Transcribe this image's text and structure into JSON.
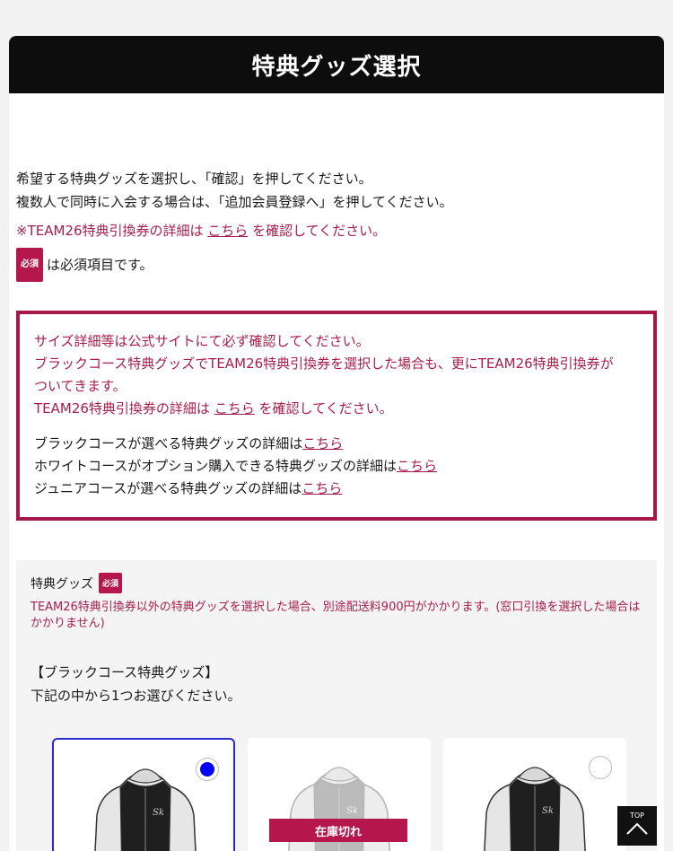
{
  "header": {
    "title": "特典グッズ選択"
  },
  "intro": {
    "line1": "希望する特典グッズを選択し、「確認」を押してください。",
    "line2": "複数人で同時に入会する場合は、「追加会員登録へ」を押してください。",
    "notice_prefix": "※TEAM26特典引換券の詳細は",
    "notice_link": "こちら",
    "notice_suffix": "を確認してください。",
    "required_badge": "必須",
    "required_text": "は必須項目です。"
  },
  "notice_box": {
    "line1": "サイズ詳細等は公式サイトにて必ず確認してください。",
    "line2": "ブラックコース特典グッズでTEAM26特典引換券を選択した場合も、更にTEAM26特典引換券が",
    "line3": "ついてきます。",
    "line4_prefix": "TEAM26特典引換券の詳細は",
    "line4_link": "こちら",
    "line4_suffix": "を確認してください。",
    "black_text": "ブラックコースが選べる特典グッズの詳細は",
    "black_link": "こちら",
    "white_text": "ホワイトコースがオプション購入できる特典グッズの詳細は",
    "white_link": "こちら",
    "junior_text": "ジュニアコースが選べる特典グッズの詳細は",
    "junior_link": "こちら"
  },
  "goods": {
    "title": "特典グッズ",
    "required_badge": "必須",
    "note": "TEAM26特典引換券以外の特典グッズを選択した場合、別途配送料900円がかかります。(窓口引換を選択した場合はかかりません)",
    "section_title": "【ブラックコース特典グッズ】",
    "section_sub": "下記の中から1つお選びください。",
    "items": [
      {
        "selected": true,
        "out_of_stock": false,
        "stock_label": ""
      },
      {
        "selected": false,
        "out_of_stock": true,
        "stock_label": "在庫切れ"
      },
      {
        "selected": false,
        "out_of_stock": false,
        "stock_label": ""
      }
    ]
  },
  "top_button": {
    "label": "TOP"
  },
  "colors": {
    "accent": "#a81d4a",
    "badge": "#b5164b",
    "radio_selected": "#0000ff",
    "header_bg": "#0d0d0d"
  }
}
